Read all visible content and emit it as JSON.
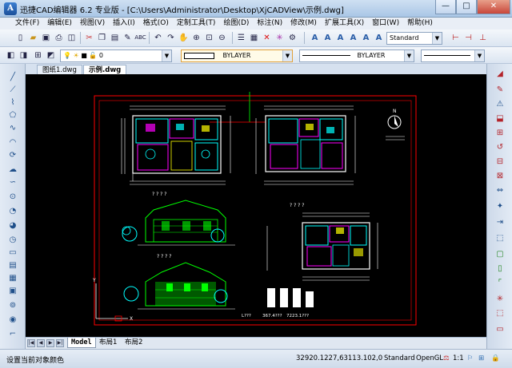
{
  "window": {
    "title": "迅捷CAD编辑器 6.2 专业版 - [C:\\Users\\Administrator\\Desktop\\XjCADView\\示例.dwg]",
    "app_icon_letter": "A",
    "minimize": "—",
    "maximize": "□",
    "close": "✕"
  },
  "menu": [
    "文件(F)",
    "编辑(E)",
    "视图(V)",
    "插入(I)",
    "格式(O)",
    "定制工具(T)",
    "绘图(D)",
    "标注(N)",
    "修改(M)",
    "扩展工具(X)",
    "窗口(W)",
    "帮助(H)"
  ],
  "toolbar": {
    "text_style": "Standard",
    "layer_value": "0",
    "color": "BYLAYER",
    "linetype": "BYLAYER"
  },
  "doc_tabs": [
    {
      "label": "图纸1.dwg"
    },
    {
      "label": "示例.dwg"
    }
  ],
  "drawing": {
    "north_label": "N",
    "bottom_left_text": "L???",
    "bottom_mid_text": "367.4???",
    "bottom_right_text": "7223.1???",
    "elev_label_1": "? ? ? ?",
    "elev_label_2": "? ? ? ?",
    "plan_label_1": "? ? ? ?",
    "plan_label_2": "? ? ? ?",
    "plan_label_3": "? ? ? ?",
    "ucs_y": "Y",
    "ucs_x": "X"
  },
  "layout_tabs": {
    "nav": [
      "|◀",
      "◀",
      "▶",
      "▶|"
    ],
    "tabs": [
      "Model",
      "布局1",
      "布局2"
    ]
  },
  "status": {
    "message": "设置当前对象颜色",
    "coords": "32920.1227,63113.102,0",
    "style": "Standard",
    "renderer": "OpenGL",
    "scale": "1:1"
  },
  "colors": {
    "canvas": "#000000",
    "border": "#ff0000",
    "walls": "#ffffff",
    "cyan": "#00ffff",
    "magenta": "#ff00ff",
    "green": "#00ff00",
    "yellow": "#ffff00"
  }
}
